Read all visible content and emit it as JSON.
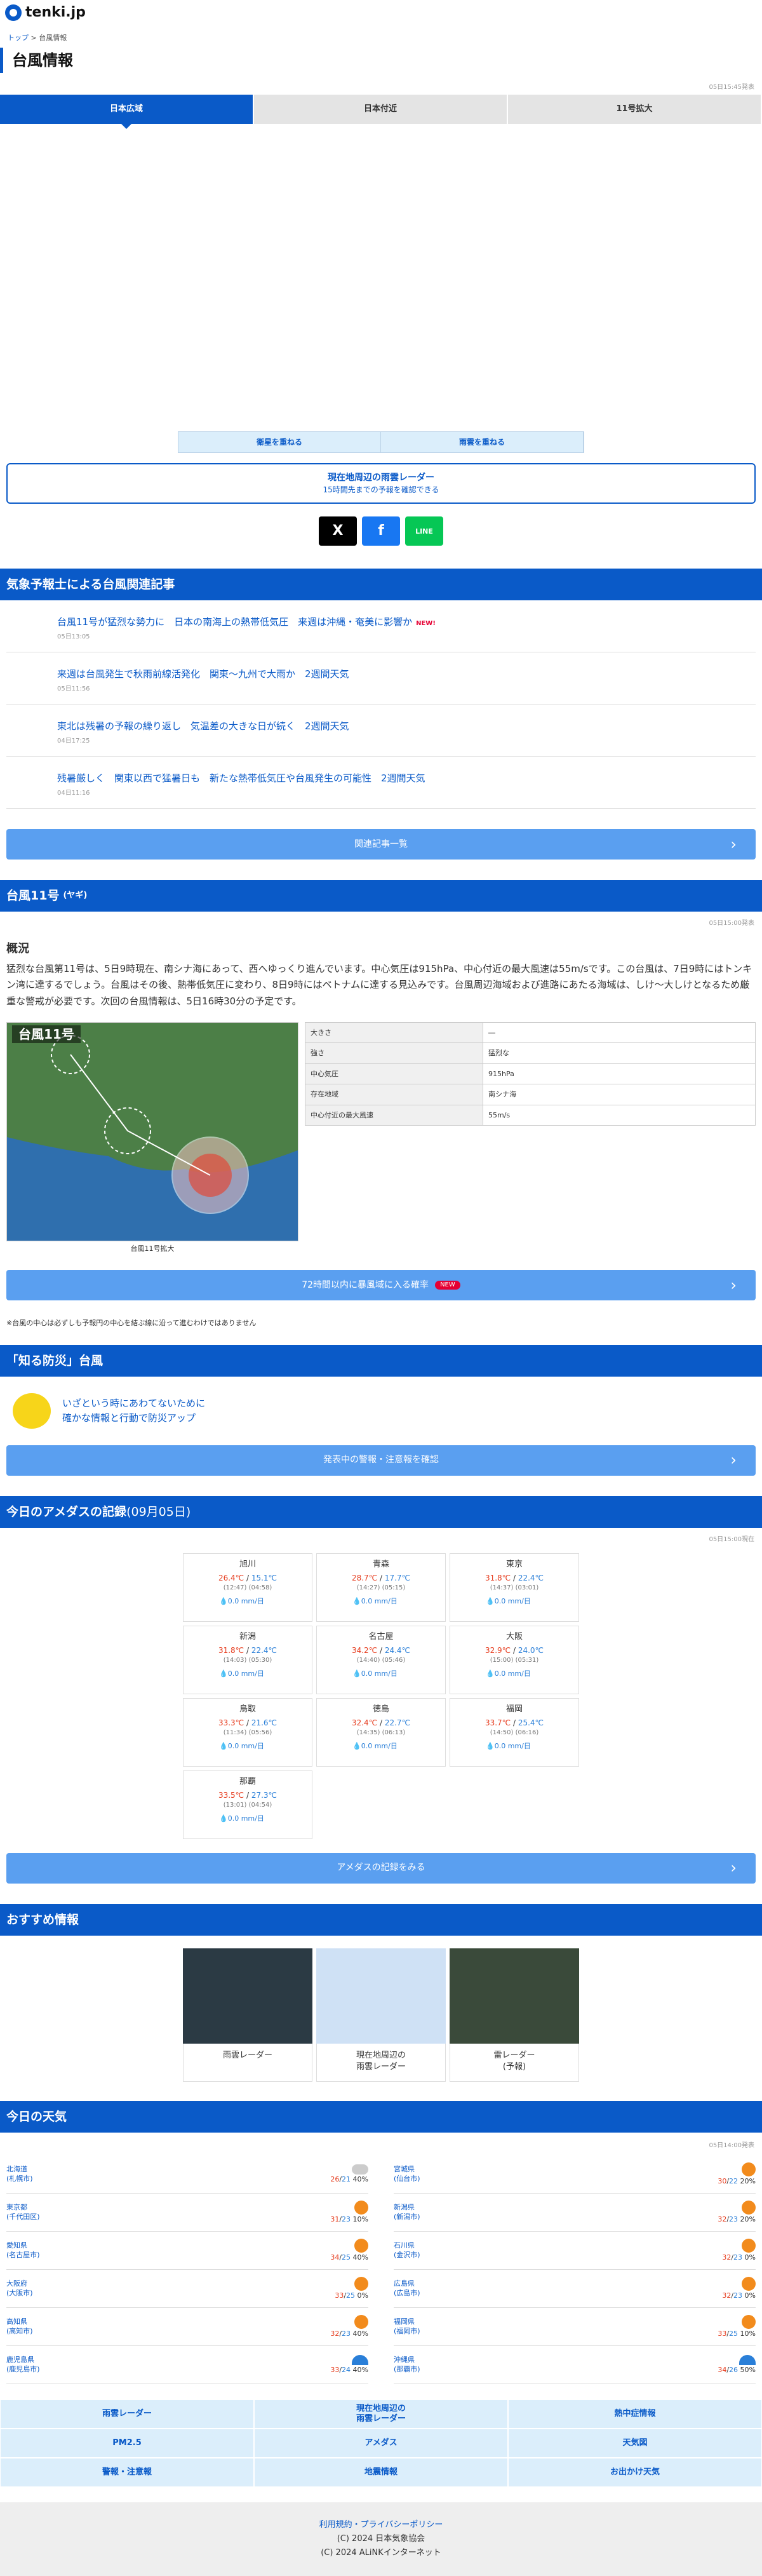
{
  "logo": "tenki.jp",
  "breadcrumb": {
    "top": "トップ",
    "sep": ">",
    "current": "台風情報"
  },
  "title": "台風情報",
  "header_ts": "05日15:45発表",
  "tabs": [
    "日本広域",
    "日本付近",
    "11号拡大"
  ],
  "overlay": [
    "衛星を重ねる",
    "雨雲を重ねる"
  ],
  "radar_btn": {
    "t1": "現在地周辺の雨雲レーダー",
    "t2": "15時間先までの予報を確認できる"
  },
  "share": [
    "X",
    "f",
    "LINE"
  ],
  "articles_title": "気象予報士による台風関連記事",
  "articles": [
    {
      "title": "台風11号が猛烈な勢力に　日本の南海上の熱帯低気圧　来週は沖縄・奄美に影響か",
      "new": "NEW!",
      "date": "05日13:05"
    },
    {
      "title": "来週は台風発生で秋雨前線活発化　関東〜九州で大雨か　2週間天気",
      "new": "",
      "date": "05日11:56"
    },
    {
      "title": "東北は残暑の予報の繰り返し　気温差の大きな日が続く　2週間天気",
      "new": "",
      "date": "04日17:25"
    },
    {
      "title": "残暑厳しく　関東以西で猛暑日も　新たな熱帯低気圧や台風発生の可能性　2週間天気",
      "new": "",
      "date": "04日11:16"
    }
  ],
  "articles_more": "関連記事一覧",
  "typhoon": {
    "title": "台風11号",
    "name": "(ヤギ)",
    "ts": "05日15:00発表",
    "gaikyo": "概況",
    "text": "猛烈な台風第11号は、5日9時現在、南シナ海にあって、西へゆっくり進んでいます。中心気圧は915hPa、中心付近の最大風速は55m/sです。この台風は、7日9時にはトンキン湾に達するでしょう。台風はその後、熱帯低気圧に変わり、8日9時にはベトナムに達する見込みです。台風周辺海域および進路にあたる海域は、しけ～大しけとなるため厳重な警戒が必要です。次回の台風情報は、5日16時30分の予定です。",
    "map_title": "台風11号",
    "map_caption": "台風11号拡大",
    "rows": [
      {
        "k": "大きさ",
        "v": "―"
      },
      {
        "k": "強さ",
        "v": "猛烈な"
      },
      {
        "k": "中心気圧",
        "v": "915hPa"
      },
      {
        "k": "存在地域",
        "v": "南シナ海"
      },
      {
        "k": "中心付近の最大風速",
        "v": "55m/s"
      }
    ],
    "prob_btn": "72時間以内に暴風域に入る確率",
    "prob_badge": "NEW",
    "note": "※台風の中心は必ずしも予報円の中心を結ぶ線に沿って進むわけではありません"
  },
  "bosai": {
    "title": "「知る防災」台風",
    "line1": "いざという時にあわてないために",
    "line2": "確かな情報と行動で防災アップ",
    "btn": "発表中の警報・注意報を確認"
  },
  "amedas": {
    "title": "今日のアメダスの記録",
    "date": "(09月05日)",
    "ts": "05日15:00現在",
    "items": [
      {
        "n": "旭川",
        "hi": "26.4℃",
        "lo": "15.1℃",
        "th": "(12:47)",
        "tl": "(04:58)",
        "r": "0.0 mm/日"
      },
      {
        "n": "青森",
        "hi": "28.7℃",
        "lo": "17.7℃",
        "th": "(14:27)",
        "tl": "(05:15)",
        "r": "0.0 mm/日"
      },
      {
        "n": "東京",
        "hi": "31.8℃",
        "lo": "22.4℃",
        "th": "(14:37)",
        "tl": "(03:01)",
        "r": "0.0 mm/日"
      },
      {
        "n": "新潟",
        "hi": "31.8℃",
        "lo": "22.4℃",
        "th": "(14:03)",
        "tl": "(05:30)",
        "r": "0.0 mm/日"
      },
      {
        "n": "名古屋",
        "hi": "34.2℃",
        "lo": "24.4℃",
        "th": "(14:40)",
        "tl": "(05:46)",
        "r": "0.0 mm/日"
      },
      {
        "n": "大阪",
        "hi": "32.9℃",
        "lo": "24.0℃",
        "th": "(15:00)",
        "tl": "(05:31)",
        "r": "0.0 mm/日"
      },
      {
        "n": "鳥取",
        "hi": "33.3℃",
        "lo": "21.6℃",
        "th": "(11:34)",
        "tl": "(05:56)",
        "r": "0.0 mm/日"
      },
      {
        "n": "徳島",
        "hi": "32.4℃",
        "lo": "22.7℃",
        "th": "(14:35)",
        "tl": "(06:13)",
        "r": "0.0 mm/日"
      },
      {
        "n": "福岡",
        "hi": "33.7℃",
        "lo": "25.4℃",
        "th": "(14:50)",
        "tl": "(06:16)",
        "r": "0.0 mm/日"
      },
      {
        "n": "那覇",
        "hi": "33.5℃",
        "lo": "27.3℃",
        "th": "(13:01)",
        "tl": "(04:54)",
        "r": "0.0 mm/日"
      }
    ],
    "btn": "アメダスの記録をみる"
  },
  "recommend": {
    "title": "おすすめ情報",
    "items": [
      "雨雲レーダー",
      "現在地周辺の\n雨雲レーダー",
      "雷レーダー\n(予報)"
    ]
  },
  "today": {
    "title": "今日の天気",
    "ts": "05日14:00発表",
    "left": [
      {
        "p": "北海道",
        "c": "(札幌市)",
        "t": "26",
        "l": "21",
        "r": "40%",
        "i": "cloud"
      },
      {
        "p": "東京都",
        "c": "(千代田区)",
        "t": "31",
        "l": "23",
        "r": "10%",
        "i": "sun"
      },
      {
        "p": "愛知県",
        "c": "(名古屋市)",
        "t": "34",
        "l": "25",
        "r": "40%",
        "i": "sun"
      },
      {
        "p": "大阪府",
        "c": "(大阪市)",
        "t": "33",
        "l": "25",
        "r": "0%",
        "i": "sun"
      },
      {
        "p": "高知県",
        "c": "(高知市)",
        "t": "32",
        "l": "23",
        "r": "40%",
        "i": "sun"
      },
      {
        "p": "鹿児島県",
        "c": "(鹿児島市)",
        "t": "33",
        "l": "24",
        "r": "40%",
        "i": "umb"
      }
    ],
    "right": [
      {
        "p": "宮城県",
        "c": "(仙台市)",
        "t": "30",
        "l": "22",
        "r": "20%",
        "i": "sun"
      },
      {
        "p": "新潟県",
        "c": "(新潟市)",
        "t": "32",
        "l": "23",
        "r": "20%",
        "i": "sun"
      },
      {
        "p": "石川県",
        "c": "(金沢市)",
        "t": "32",
        "l": "23",
        "r": "0%",
        "i": "sun"
      },
      {
        "p": "広島県",
        "c": "(広島市)",
        "t": "32",
        "l": "23",
        "r": "0%",
        "i": "sun"
      },
      {
        "p": "福岡県",
        "c": "(福岡市)",
        "t": "33",
        "l": "25",
        "r": "10%",
        "i": "sun"
      },
      {
        "p": "沖縄県",
        "c": "(那覇市)",
        "t": "34",
        "l": "26",
        "r": "50%",
        "i": "umb"
      }
    ]
  },
  "bottom_nav": [
    "雨雲レーダー",
    "現在地周辺の\n雨雲レーダー",
    "熱中症情報",
    "PM2.5",
    "アメダス",
    "天気図",
    "警報・注意報",
    "地震情報",
    "お出かけ天気"
  ],
  "footer": [
    "利用規約・プライバシーポリシー",
    "(C) 2024 日本気象協会",
    "(C) 2024 ALiNKインターネット"
  ]
}
